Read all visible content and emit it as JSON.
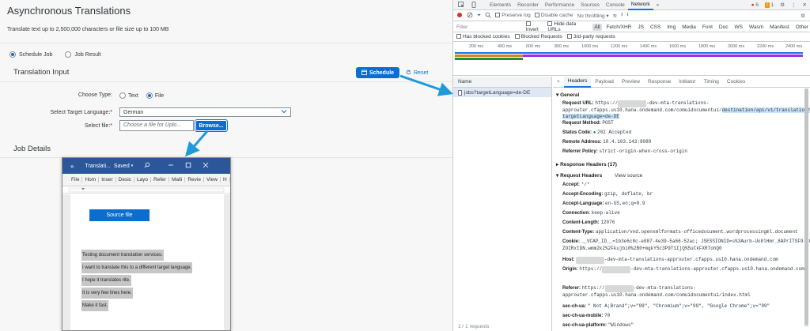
{
  "app": {
    "title": "Asynchronous Translations",
    "subtitle": "Translate text up to 2,500,000 characters or file size up to 100 MB",
    "mode_options": [
      "Schedule Job",
      "Job Result"
    ],
    "input_section": "Translation Input",
    "schedule_label": "Schedule",
    "reset_label": "Reset",
    "choose_type_label": "Choose Type:",
    "type_options": [
      "Text",
      "File"
    ],
    "target_lang_label": "Select Target Language:",
    "target_lang_value": "German",
    "select_file_label": "Select file:",
    "file_placeholder": "Choose a file for Uplo...",
    "browse_label": "Browse...",
    "job_details": "Job Details",
    "required_mark": "*"
  },
  "word": {
    "menu_glyph": "»",
    "title": "Translati...",
    "saved": "Saved",
    "tabs": [
      "File",
      "Hom",
      "Inser",
      "Desic",
      "Layo",
      "Refer",
      "Maili",
      "Revie",
      "View",
      "H"
    ],
    "source_button": "Source file",
    "lines": [
      "Testing document translation services.",
      "I want to translate this to a different target language.",
      "I hope it translates rite.",
      "It is very few lines here.",
      "Make it fast."
    ]
  },
  "devtools": {
    "tabs": [
      "Elements",
      "Recorder",
      "Performance",
      "Sources",
      "Console",
      "Network"
    ],
    "active_tab": "Network",
    "more_tabs": "»",
    "error_count": "6",
    "warn_count": "1",
    "toolbar": {
      "preserve_log": "Preserve log",
      "disable_cache": "Disable cache",
      "throttling": "No throttling"
    },
    "filter_placeholder": "Filter",
    "invert": "Invert",
    "hide_data_urls": "Hide data URLs",
    "filter_types": [
      "All",
      "Fetch/XHR",
      "JS",
      "CSS",
      "Img",
      "Media",
      "Font",
      "Doc",
      "WS",
      "Wasm",
      "Manifest",
      "Other"
    ],
    "blocked_cookies": "Has blocked cookies",
    "blocked_requests": "Blocked Requests",
    "third_party": "3rd-party requests",
    "timeline_ticks": [
      "200 ms",
      "400 ms",
      "600 ms",
      "800 ms",
      "1000 ms",
      "1200 ms",
      "1400 ms",
      "1600 ms",
      "1800 ms",
      "2000 ms",
      "2200 ms",
      "2400 ms"
    ],
    "request_list_header": "Name",
    "request_name": "jobs?targetLanguage=de-DE",
    "detail_close": "×",
    "detail_tabs": [
      "Headers",
      "Payload",
      "Preview",
      "Response",
      "Initiator",
      "Timing",
      "Cookies"
    ],
    "general_title": "General",
    "general": [
      {
        "k": "Request URL:",
        "v1": "https://",
        "v2": "-dev-mta-translations-approuter.cfapps.us10.hana.ondemand.com/comuidocumentui/",
        "hl": "destination/api/v1/translation/jobs?targetLanguage=de-DE"
      },
      {
        "k": "Request Method:",
        "v": "POST"
      },
      {
        "k": "Status Code:",
        "v": "202 Accepted"
      },
      {
        "k": "Remote Address:",
        "v": "10.4.103.143:8080"
      },
      {
        "k": "Referrer Policy:",
        "v": "strict-origin-when-cross-origin"
      }
    ],
    "response_headers_title": "Response Headers (17)",
    "request_headers_title": "Request Headers",
    "view_source": "View source",
    "request_headers": [
      {
        "k": "Accept:",
        "v": "*/*"
      },
      {
        "k": "Accept-Encoding:",
        "v": "gzip, deflate, br"
      },
      {
        "k": "Accept-Language:",
        "v": "en-US,en;q=0.9"
      },
      {
        "k": "Connection:",
        "v": "keep-alive"
      },
      {
        "k": "Content-Length:",
        "v": "12076"
      },
      {
        "k": "Content-Type:",
        "v": "application/vnd.openxmlformats-officedocument.wordprocessingml.document"
      },
      {
        "k": "Cookie:",
        "v": "__VCAP_ID__=1b3e6c8c-e087-4e39-5a66-52ac; JSESSIONID=s%3Aurb-Uo8lHmr_8APrITSF9-kUZOIRxtDN.wmm2k2%2Fkujbi0%2B0+mgkY5c3P9T1IjQ%5uCkFXR7ohQ0"
      },
      {
        "k": "Host:",
        "v": "-dev-mta-translations-approuter.cfapps.us10.hana.ondemand.com"
      },
      {
        "k": "Origin:",
        "v": "https://",
        "v2": "-dev-mta-translations-approuter.cfapps.us10.hana.ondemand.com"
      },
      {
        "k": "Referer:",
        "v": "https://",
        "v2": "-dev-mta-translations-approuter.cfapps.us10.hana.ondemand.com/comuidocumentui/index.html"
      },
      {
        "k": "sec-ch-ua:",
        "v": "\" Not A;Brand\";v=\"99\", \"Chromium\";v=\"99\", \"Google Chrome\";v=\"99\""
      },
      {
        "k": "sec-ch-ua-mobile:",
        "v": "?0"
      },
      {
        "k": "sec-ch-ua-platform:",
        "v": "\"Windows\""
      }
    ],
    "bottom_status": "1 / 1 requests",
    "colors": {
      "accent": "#1a73e8",
      "ok": "#1e8e3e"
    }
  },
  "colors": {
    "sap_blue": "#0a6ed1",
    "word_blue": "#2b579a",
    "arrow": "#1e9ad6"
  }
}
